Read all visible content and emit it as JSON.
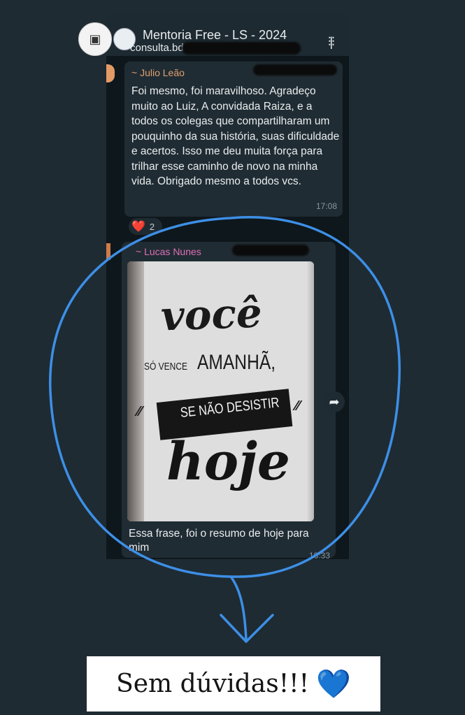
{
  "chat_header": {
    "group_name": "Mentoria Free - LS - 2024",
    "subtitle": "consulta.bd",
    "avatar_glyph": "▣"
  },
  "messages": [
    {
      "sender": "~ Julio Leão",
      "sender_color": "#e0a070",
      "text": "Foi mesmo, foi maravilhoso. Agradeço muito ao Luiz, A convidada Raiza, e a todos os colegas que compartilharam um pouquinho da sua história, suas dificuldade e acertos. Isso me deu muita força para trilhar esse caminho de novo na minha vida. Obrigado mesmo a todos vcs.",
      "time": "17:08",
      "reaction_emoji": "❤️",
      "reaction_count": "2"
    },
    {
      "sender": "~ Lucas Nunes",
      "sender_color": "#dd6fb8",
      "image_quote": {
        "line1": "você",
        "line2a": "SÓ VENCE",
        "line2b": "AMANHÃ,",
        "line3": "SE NÃO DESISTIR",
        "line4": "hoje"
      },
      "caption": "Essa frase, foi o resumo de hoje para mim",
      "time": "18:33"
    }
  ],
  "overlay": {
    "caption_text": "Sem dúvidas!!!",
    "emoji": "💙",
    "circle_color": "#3d8fe6"
  }
}
